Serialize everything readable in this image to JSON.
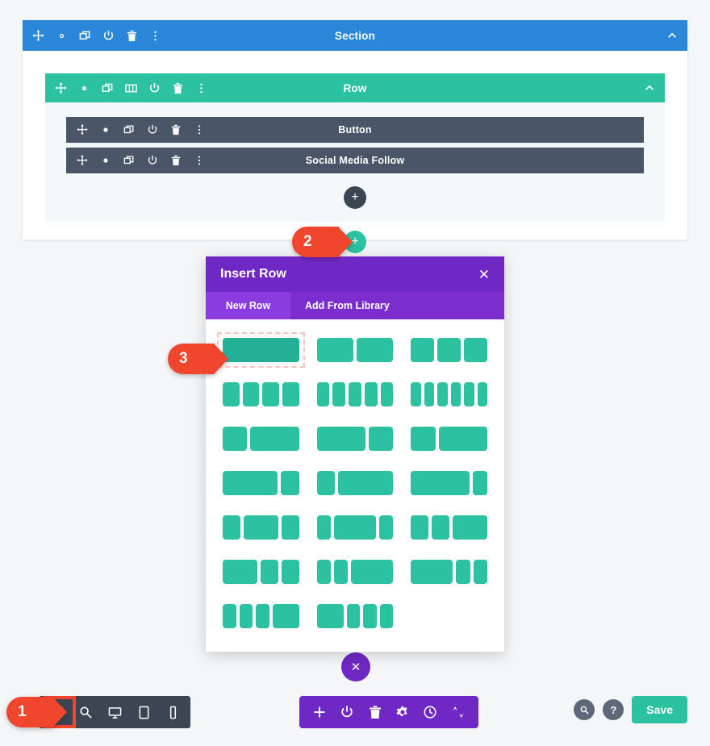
{
  "section": {
    "title": "Section",
    "color": "#2b87da",
    "toolbar_icons": [
      "move-icon",
      "gear-icon",
      "duplicate-icon",
      "power-icon",
      "trash-icon",
      "dots-menu-icon"
    ],
    "collapse_icon": "chevron-up-icon"
  },
  "row": {
    "title": "Row",
    "color": "#2cc1a0",
    "toolbar_icons": [
      "move-icon",
      "gear-icon",
      "duplicate-icon",
      "columns-icon",
      "power-icon",
      "trash-icon",
      "dots-menu-icon"
    ],
    "collapse_icon": "chevron-up-icon",
    "modules": [
      {
        "title": "Button",
        "toolbar_icons": [
          "move-icon",
          "gear-icon",
          "duplicate-icon",
          "power-icon",
          "trash-icon",
          "dots-menu-icon"
        ]
      },
      {
        "title": "Social Media Follow",
        "toolbar_icons": [
          "move-icon",
          "gear-icon",
          "duplicate-icon",
          "power-icon",
          "trash-icon",
          "dots-menu-icon"
        ]
      }
    ],
    "add_module_label": "+",
    "add_row_label": "+"
  },
  "modal": {
    "title": "Insert Row",
    "close_label": "✕",
    "tabs": [
      {
        "label": "New Row",
        "active": true
      },
      {
        "label": "Add From Library",
        "active": false
      }
    ],
    "layouts": [
      {
        "name": "1-column",
        "cols": [
          1
        ],
        "selected": true
      },
      {
        "name": "2-column-equal",
        "cols": [
          1,
          1
        ],
        "selected": false
      },
      {
        "name": "3-column-equal",
        "cols": [
          1,
          1,
          1
        ],
        "selected": false
      },
      {
        "name": "4-column-equal",
        "cols": [
          1,
          1,
          1,
          1
        ],
        "selected": false
      },
      {
        "name": "5-column-equal",
        "cols": [
          1,
          1,
          1,
          1,
          1
        ],
        "selected": false
      },
      {
        "name": "6-column-equal",
        "cols": [
          1,
          1,
          1,
          1,
          1,
          1
        ],
        "selected": false
      },
      {
        "name": "one-third-two-thirds",
        "cols": [
          1,
          2
        ],
        "selected": false
      },
      {
        "name": "two-thirds-one-third",
        "cols": [
          2,
          1
        ],
        "selected": false
      },
      {
        "name": "one-quarter-three-quarters",
        "cols": [
          1,
          2
        ],
        "selected": false
      },
      {
        "name": "three-quarters-one-quarter",
        "cols": [
          3,
          1
        ],
        "selected": false
      },
      {
        "name": "quarter-three-quarters",
        "cols": [
          1,
          3
        ],
        "selected": false
      },
      {
        "name": "three-quarters-quarter-b",
        "cols": [
          4,
          1
        ],
        "selected": false
      },
      {
        "name": "quarter-half-quarter",
        "cols": [
          1,
          2,
          1
        ],
        "selected": false
      },
      {
        "name": "quarter-half-quarter-b",
        "cols": [
          1,
          3,
          1
        ],
        "selected": false
      },
      {
        "name": "quarter-quarter-half",
        "cols": [
          1,
          1,
          2
        ],
        "selected": false
      },
      {
        "name": "half-quarter-quarter",
        "cols": [
          2,
          1,
          1
        ],
        "selected": false
      },
      {
        "name": "quarter-quarter-half-b",
        "cols": [
          1,
          1,
          3
        ],
        "selected": false
      },
      {
        "name": "half-quarter-quarter-b",
        "cols": [
          3,
          1,
          1
        ],
        "selected": false
      },
      {
        "name": "three-sixths-half",
        "cols": [
          1,
          1,
          1,
          2
        ],
        "selected": false
      },
      {
        "name": "half-three-sixths",
        "cols": [
          2,
          1,
          1,
          1
        ],
        "selected": false
      }
    ]
  },
  "page_close": {
    "label": "✕"
  },
  "view_bar": {
    "items": [
      {
        "name": "wireframe-view",
        "icon": "wireframe-icon",
        "active": true
      },
      {
        "name": "zoom-view",
        "icon": "magnifier-icon",
        "active": false
      },
      {
        "name": "desktop-view",
        "icon": "desktop-icon",
        "active": false
      },
      {
        "name": "tablet-view",
        "icon": "tablet-icon",
        "active": false
      },
      {
        "name": "phone-view",
        "icon": "phone-icon",
        "active": false
      }
    ]
  },
  "main_toolbar": {
    "items": [
      {
        "name": "add-section",
        "icon": "plus-icon"
      },
      {
        "name": "toggle-visibility",
        "icon": "power-icon"
      },
      {
        "name": "delete",
        "icon": "trash-icon"
      },
      {
        "name": "settings",
        "icon": "gear-icon"
      },
      {
        "name": "history",
        "icon": "clock-icon"
      },
      {
        "name": "sort",
        "icon": "up-down-arrows-icon"
      }
    ]
  },
  "right_tools": {
    "search_label": "⚲",
    "help_label": "?",
    "save_label": "Save"
  },
  "markers": [
    {
      "id": "1",
      "label": "1"
    },
    {
      "id": "2",
      "label": "2"
    },
    {
      "id": "3",
      "label": "3"
    }
  ],
  "colors": {
    "section": "#2b87da",
    "row": "#2cc1a0",
    "module": "#4a5567",
    "modal": "#7028c4",
    "marker": "#f0462d",
    "page_bg": "#f4f6f8"
  }
}
